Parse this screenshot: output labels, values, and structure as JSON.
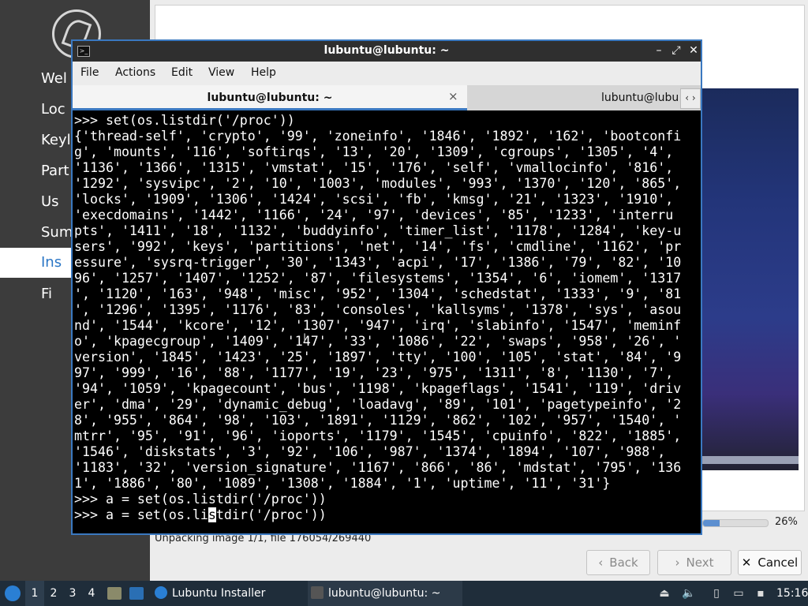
{
  "installer": {
    "steps": [
      "Wel",
      "Loc",
      "Keyl",
      "Part",
      "Us",
      "Sum",
      "Ins",
      "Fi"
    ],
    "active_step_index": 6,
    "progress_percent": 26,
    "progress_label": "26%",
    "status": "Unpacking image 1/1, file 176054/269440",
    "buttons": {
      "back": "Back",
      "next": "Next",
      "cancel": "Cancel"
    }
  },
  "terminal": {
    "title": "lubuntu@lubuntu: ~",
    "menu": [
      "File",
      "Actions",
      "Edit",
      "View",
      "Help"
    ],
    "tabs": [
      {
        "label": "lubuntu@lubuntu: ~",
        "close": "×"
      },
      {
        "label": "lubuntu@lubu"
      }
    ],
    "lines": [
      ">>> set(os.listdir('/proc'))",
      "{'thread-self', 'crypto', '99', 'zoneinfo', '1846', '1892', '162', 'bootconfi",
      "g', 'mounts', '116', 'softirqs', '13', '20', '1309', 'cgroups', '1305', '4',",
      "'1136', '1366', '1315', 'vmstat', '15', '176', 'self', 'vmallocinfo', '816',",
      "'1292', 'sysvipc', '2', '10', '1003', 'modules', '993', '1370', '120', '865',",
      "'locks', '1909', '1306', '1424', 'scsi', 'fb', 'kmsg', '21', '1323', '1910',",
      "'execdomains', '1442', '1166', '24', '97', 'devices', '85', '1233', 'interru",
      "pts', '1411', '18', '1132', 'buddyinfo', 'timer_list', '1178', '1284', 'key-u",
      "sers', '992', 'keys', 'partitions', 'net', '14', 'fs', 'cmdline', '1162', 'pr",
      "essure', 'sysrq-trigger', '30', '1343', 'acpi', '17', '1386', '79', '82', '10",
      "96', '1257', '1407', '1252', '87', 'filesystems', '1354', '6', 'iomem', '1317",
      "', '1120', '163', '948', 'misc', '952', '1304', 'schedstat', '1333', '9', '81",
      "', '1296', '1395', '1176', '83', 'consoles', 'kallsyms', '1378', 'sys', 'asou",
      "nd', '1544', 'kcore', '12', '1307', '947', 'irq', 'slabinfo', '1547', 'meminf",
      "o', 'kpagecgroup', '1409', '147', '33', '1086', '22', 'swaps', '958', '26', '",
      "version', '1845', '1423', '25', '1897', 'tty', '100', '105', 'stat', '84', '9",
      "97', '999', '16', '88', '1177', '19', '23', '975', '1311', '8', '1130', '7',",
      "'94', '1059', 'kpagecount', 'bus', '1198', 'kpageflags', '1541', '119', 'driv",
      "er', 'dma', '29', 'dynamic_debug', 'loadavg', '89', '101', 'pagetypeinfo', '2",
      "8', '955', '864', '98', '103', '1891', '1129', '862', '102', '957', '1540', '",
      "mtrr', '95', '91', '96', 'ioports', '1179', '1545', 'cpuinfo', '822', '1885',",
      "'1546', 'diskstats', '3', '92', '106', '987', '1374', '1894', '107', '988',",
      "'1183', '32', 'version_signature', '1167', '866', '86', 'mdstat', '795', '136",
      "1', '1886', '80', '1089', '1308', '1884', '1', 'uptime', '11', '31'}",
      ">>> a = set(os.listdir('/proc'))"
    ],
    "current_line": {
      "before_cursor": ">>> a = set(os.li",
      "cursor_char": "s",
      "after_cursor": "tdir('/proc'))"
    }
  },
  "taskbar": {
    "workspaces": [
      "1",
      "2",
      "3",
      "4"
    ],
    "active_workspace_index": 0,
    "tasks": [
      {
        "label": "Lubuntu Installer"
      },
      {
        "label": "lubuntu@lubuntu: ~"
      }
    ],
    "clock": "15:16"
  },
  "colors": {
    "accent": "#3a78c0",
    "taskbar": "#1f2d3a",
    "sidebar": "#3c3c3c",
    "terminal_bg": "#000000"
  }
}
